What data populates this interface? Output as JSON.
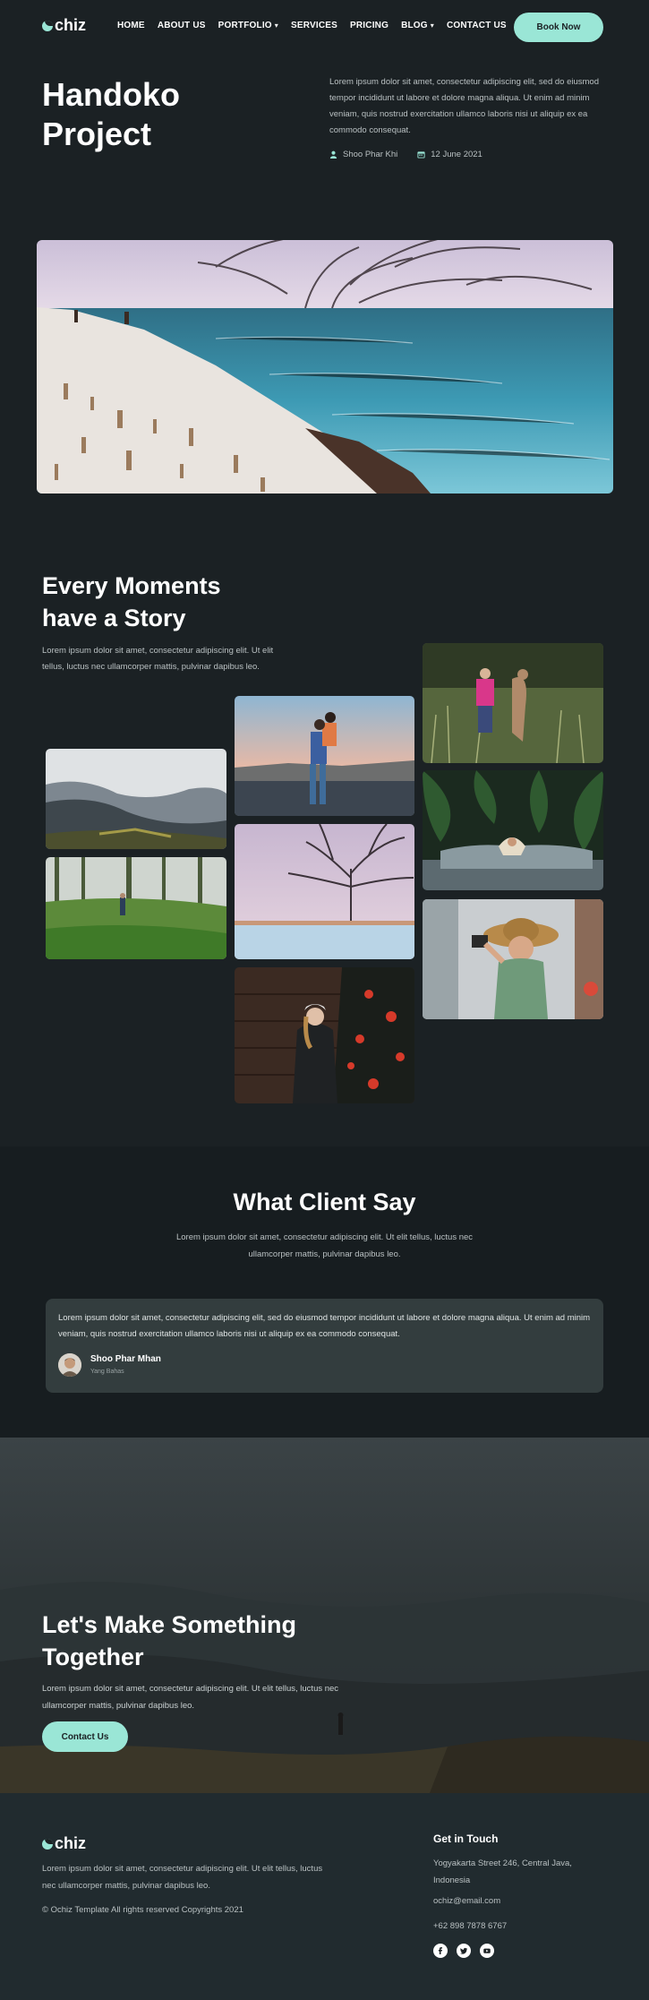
{
  "brand": {
    "logo_text": "chiz",
    "accent": "#9ae6d6",
    "bg": "#1b2124"
  },
  "nav": {
    "items": [
      {
        "label": "HOME"
      },
      {
        "label": "ABOUT US"
      },
      {
        "label": "PORTFOLIO",
        "dropdown": true
      },
      {
        "label": "SERVICES"
      },
      {
        "label": "PRICING"
      },
      {
        "label": "BLOG",
        "dropdown": true
      },
      {
        "label": "CONTACT US"
      }
    ],
    "cta": "Book Now"
  },
  "hero": {
    "title_line1": "Handoko",
    "title_line2": "Project",
    "description": "Lorem ipsum dolor sit amet, consectetur adipiscing elit, sed do eiusmod tempor incididunt ut labore et dolore magna aliqua. Ut enim ad minim veniam, quis nostrud exercitation ullamco laboris nisi ut aliquip ex ea commodo consequat.",
    "author": "Shoo Phar Khi",
    "date": "12 June 2021"
  },
  "moments": {
    "title_line1": "Every Moments",
    "title_line2": "have a Story",
    "description": "Lorem ipsum dolor sit amet, consectetur adipiscing elit. Ut elit tellus, luctus nec ullamcorper mattis, pulvinar dapibus leo."
  },
  "clients": {
    "title": "What Client Say",
    "description": "Lorem ipsum dolor sit amet, consectetur adipiscing elit. Ut elit tellus, luctus nec ullamcorper mattis, pulvinar dapibus leo.",
    "testimonial": {
      "text": "Lorem ipsum dolor sit amet, consectetur adipiscing elit, sed do eiusmod tempor incididunt ut labore et dolore magna aliqua. Ut enim ad minim veniam, quis nostrud exercitation ullamco laboris nisi ut aliquip ex ea commodo consequat.",
      "name": "Shoo Phar Mhan",
      "role": "Yang Bahas"
    }
  },
  "cta": {
    "title_line1": "Let's Make Something",
    "title_line2": "Together",
    "description": "Lorem ipsum dolor sit amet, consectetur adipiscing elit. Ut elit tellus, luctus nec ullamcorper mattis, pulvinar dapibus leo.",
    "button": "Contact Us"
  },
  "footer": {
    "description": "Lorem ipsum dolor sit amet, consectetur adipiscing elit. Ut elit tellus, luctus nec ullamcorper mattis, pulvinar dapibus leo.",
    "copyright": "© Ochiz Template All rights reserved Copyrights 2021",
    "contact_heading": "Get in Touch",
    "address": "Yogyakarta Street 246, Central Java, Indonesia",
    "email": "ochiz@email.com",
    "phone": "+62 898 7878 6767",
    "socials": [
      "facebook-icon",
      "twitter-icon",
      "youtube-icon"
    ]
  }
}
